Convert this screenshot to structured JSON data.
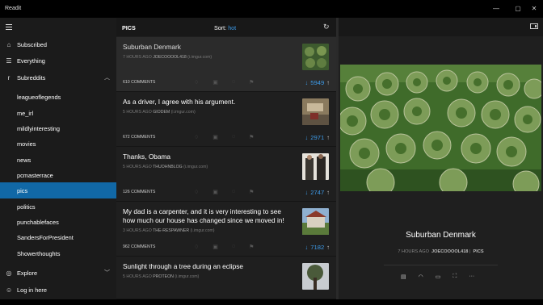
{
  "window": {
    "title": "Readit",
    "controls": {
      "minimize": "—",
      "maximize": "▢",
      "close": "✕"
    }
  },
  "sidebar": {
    "items": [
      {
        "label": "Subscribed",
        "icon": "home-icon"
      },
      {
        "label": "Everything",
        "icon": "list-icon"
      },
      {
        "label": "Subreddits",
        "icon": "subreddit-icon"
      }
    ],
    "subreddits": [
      "leagueoflegends",
      "me_irl",
      "mildlyinteresting",
      "movies",
      "news",
      "pcmasterrace",
      "pics",
      "politics",
      "punchablefaces",
      "SandersForPresident",
      "Showerthoughts"
    ],
    "active_subreddit": "pics",
    "explore_label": "Explore",
    "login_label": "Log in here"
  },
  "list": {
    "subreddit": "PICS",
    "sort_label": "Sort:",
    "sort_value": "hot",
    "posts": [
      {
        "title": "Suburban Denmark",
        "time": "7 HOURS AGO",
        "author": "JOECOOOOL418",
        "domain": "(i.imgur.com)",
        "comments": "610 COMMENTS",
        "score": "5949"
      },
      {
        "title": "As a driver, I agree with his argument.",
        "time": "5 HOURS AGO",
        "author": "GIODEM",
        "domain": "(i.imgur.com)",
        "comments": "672 COMMENTS",
        "score": "2971"
      },
      {
        "title": "Thanks, Obama",
        "time": "5 HOURS AGO",
        "author": "THUOHNBLOG",
        "domain": "(i.imgur.com)",
        "comments": "126 COMMENTS",
        "score": "2747"
      },
      {
        "title": "My dad is a carpenter, and it is very interesting to see how much our house has changed since we moved in!",
        "time": "3 HOURS AGO",
        "author": "THE-RESPAWNER",
        "domain": "(i.imgur.com)",
        "comments": "962 COMMENTS",
        "score": "7182"
      },
      {
        "title": "Sunlight through a tree during an eclipse",
        "time": "5 HOURS AGO",
        "author": "PROTEON",
        "domain": "(i.imgur.com)",
        "comments": "",
        "score": ""
      }
    ]
  },
  "detail": {
    "title": "Suburban Denmark",
    "time": "7 HOURS AGO",
    "author": "JOECOOOOL418",
    "subreddit": "PICS"
  },
  "colors": {
    "accent": "#1168a6",
    "score": "#3d9be9"
  }
}
